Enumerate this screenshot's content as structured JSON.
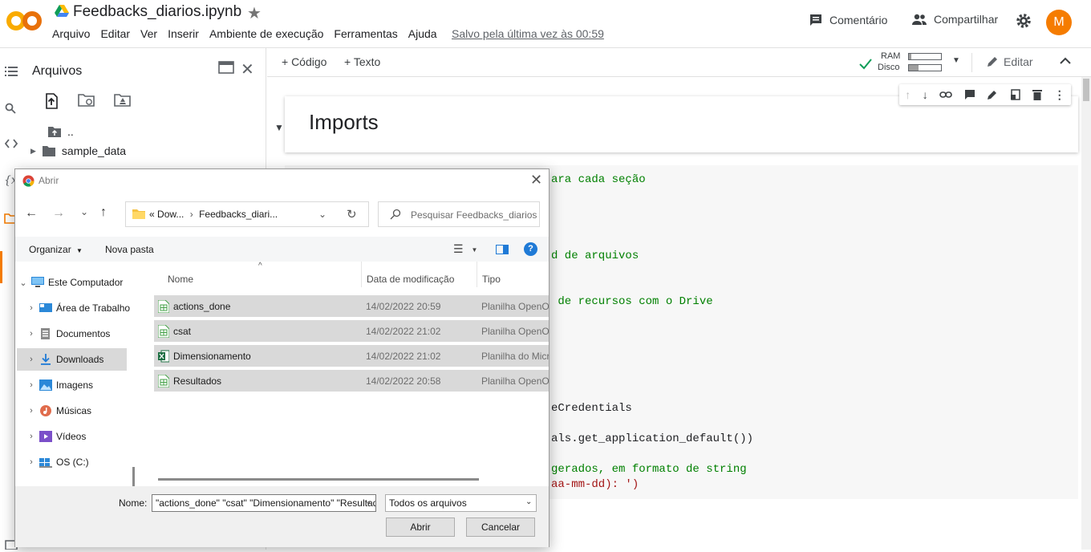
{
  "colors": {
    "accent": "#f57c00",
    "comment": "#008000",
    "string": "#a31515",
    "selection": "#d9d9d9",
    "help": "#1f7ad6"
  },
  "header": {
    "logo_text": "CO",
    "title": "Feedbacks_diarios.ipynb",
    "menu": [
      "Arquivo",
      "Editar",
      "Ver",
      "Inserir",
      "Ambiente de execução",
      "Ferramentas",
      "Ajuda"
    ],
    "saved_status": "Salvo pela última vez às 00:59",
    "comment_label": "Comentário",
    "share_label": "Compartilhar",
    "avatar_letter": "M"
  },
  "sidebar": {
    "title": "Arquivos",
    "parent_folder": "..",
    "folder": "sample_data"
  },
  "rail": {
    "variables_glyph": "{x"
  },
  "toolbar": {
    "add_code": "+ Código",
    "add_text": "+ Texto",
    "ram_label": "RAM",
    "disk_label": "Disco",
    "edit_label": "Editar"
  },
  "notebook": {
    "heading": "Imports",
    "code_fragments": [
      {
        "text": "ara cada seção",
        "kind": "comment"
      },
      {
        "text": "d de arquivos",
        "kind": "comment"
      },
      {
        "text": " de recursos com o Drive",
        "kind": "comment"
      },
      {
        "text": "eCredentials",
        "kind": "normal"
      },
      {
        "text": "als.get_application_default())",
        "kind": "normal"
      },
      {
        "text": "gerados, em formato de string",
        "kind": "comment"
      },
      {
        "text": "aa-mm-dd): ')",
        "kind": "mixed"
      }
    ]
  },
  "dialog": {
    "title": "Abrir",
    "address_prefix": "«",
    "address_parts": [
      "Dow...",
      "Feedbacks_diari..."
    ],
    "search_placeholder": "Pesquisar Feedbacks_diarios",
    "organize": "Organizar",
    "new_folder": "Nova pasta",
    "help": "?",
    "nav_items": [
      {
        "label": "Este Computador",
        "icon": "computer-icon"
      },
      {
        "label": "Área de Trabalho",
        "icon": "desktop-icon"
      },
      {
        "label": "Documentos",
        "icon": "documents-icon"
      },
      {
        "label": "Downloads",
        "icon": "downloads-icon"
      },
      {
        "label": "Imagens",
        "icon": "pictures-icon"
      },
      {
        "label": "Músicas",
        "icon": "music-icon"
      },
      {
        "label": "Vídeos",
        "icon": "videos-icon"
      },
      {
        "label": "OS (C:)",
        "icon": "drive-icon"
      }
    ],
    "columns": [
      "Nome",
      "Data de modificação",
      "Tipo"
    ],
    "files": [
      {
        "name": "actions_done",
        "date": "14/02/2022 20:59",
        "type": "Planilha OpenOffice",
        "icon": "spreadsheet-icon"
      },
      {
        "name": "csat",
        "date": "14/02/2022 21:02",
        "type": "Planilha OpenOffice",
        "icon": "spreadsheet-icon"
      },
      {
        "name": "Dimensionamento",
        "date": "14/02/2022 21:02",
        "type": "Planilha do Microsoft Excel",
        "icon": "excel-icon"
      },
      {
        "name": "Resultados",
        "date": "14/02/2022 20:58",
        "type": "Planilha OpenOffice",
        "icon": "spreadsheet-icon"
      }
    ],
    "name_label": "Nome:",
    "name_value": "\"actions_done\" \"csat\" \"Dimensionamento\" \"Resultados\"",
    "file_type": "Todos os arquivos",
    "open_label": "Abrir",
    "cancel_label": "Cancelar"
  }
}
